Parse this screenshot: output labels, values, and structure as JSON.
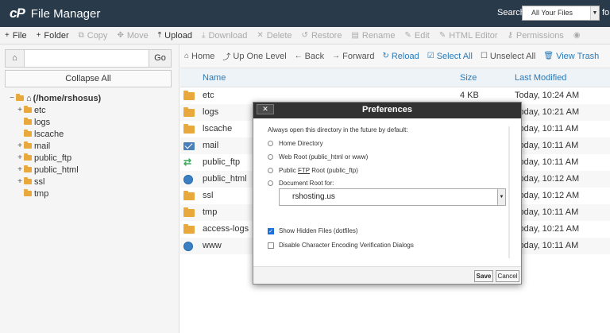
{
  "header": {
    "logo_mark": "cP",
    "title": "File Manager",
    "search_label": "Search",
    "search_scope": "All Your Files",
    "search_for_label": "fo"
  },
  "toolbar": {
    "items": [
      {
        "icon": "plus-icon",
        "glyph": "+",
        "label": "File",
        "enabled": true
      },
      {
        "icon": "plus-icon",
        "glyph": "+",
        "label": "Folder",
        "enabled": true
      },
      {
        "icon": "copy-icon",
        "glyph": "⧉",
        "label": "Copy",
        "enabled": false
      },
      {
        "icon": "move-icon",
        "glyph": "✥",
        "label": "Move",
        "enabled": false
      },
      {
        "icon": "upload-icon",
        "glyph": "⤒",
        "label": "Upload",
        "enabled": true
      },
      {
        "icon": "download-icon",
        "glyph": "⤓",
        "label": "Download",
        "enabled": false
      },
      {
        "icon": "delete-icon",
        "glyph": "✕",
        "label": "Delete",
        "enabled": false
      },
      {
        "icon": "restore-icon",
        "glyph": "↺",
        "label": "Restore",
        "enabled": false
      },
      {
        "icon": "rename-icon",
        "glyph": "▤",
        "label": "Rename",
        "enabled": false
      },
      {
        "icon": "edit-icon",
        "glyph": "✎",
        "label": "Edit",
        "enabled": false
      },
      {
        "icon": "html-editor-icon",
        "glyph": "✎",
        "label": "HTML Editor",
        "enabled": false
      },
      {
        "icon": "key-icon",
        "glyph": "⚷",
        "label": "Permissions",
        "enabled": false
      },
      {
        "icon": "view-icon",
        "glyph": "◉",
        "label": "",
        "enabled": false
      }
    ]
  },
  "left": {
    "path_value": "",
    "go_label": "Go",
    "collapse_label": "Collapse All",
    "tree": [
      {
        "toggle": "−",
        "label": "(/home/rshosus)",
        "depth": 0,
        "home": true
      },
      {
        "toggle": "+",
        "label": "etc",
        "depth": 1
      },
      {
        "toggle": "",
        "label": "logs",
        "depth": 1
      },
      {
        "toggle": "",
        "label": "lscache",
        "depth": 1
      },
      {
        "toggle": "+",
        "label": "mail",
        "depth": 1
      },
      {
        "toggle": "+",
        "label": "public_ftp",
        "depth": 1
      },
      {
        "toggle": "+",
        "label": "public_html",
        "depth": 1
      },
      {
        "toggle": "+",
        "label": "ssl",
        "depth": 1
      },
      {
        "toggle": "",
        "label": "tmp",
        "depth": 1
      }
    ]
  },
  "nav": {
    "items": [
      {
        "icon": "home-icon",
        "glyph": "⌂",
        "label": "Home",
        "blue": false
      },
      {
        "icon": "up-level-icon",
        "glyph": "⤴",
        "label": "Up One Level",
        "blue": false
      },
      {
        "icon": "back-icon",
        "glyph": "←",
        "label": "Back",
        "blue": false
      },
      {
        "icon": "forward-icon",
        "glyph": "→",
        "label": "Forward",
        "blue": false
      },
      {
        "icon": "reload-icon",
        "glyph": "↻",
        "label": "Reload",
        "blue": true
      },
      {
        "icon": "select-all-icon",
        "glyph": "☑",
        "label": "Select All",
        "blue": true
      },
      {
        "icon": "unselect-all-icon",
        "glyph": "☐",
        "label": "Unselect All",
        "blue": false
      },
      {
        "icon": "trash-icon",
        "glyph": "🗑",
        "label": "View Trash",
        "blue": true
      }
    ]
  },
  "columns": {
    "name": "Name",
    "size": "Size",
    "modified": "Last Modified"
  },
  "files": [
    {
      "name": "etc",
      "size": "4 KB",
      "modified": "Today, 10:24 AM",
      "kind": "folder"
    },
    {
      "name": "logs",
      "size": "",
      "modified": "Today, 10:21 AM",
      "kind": "folder"
    },
    {
      "name": "lscache",
      "size": "",
      "modified": "Today, 10:11 AM",
      "kind": "folder"
    },
    {
      "name": "mail",
      "size": "",
      "modified": "Today, 10:11 AM",
      "kind": "mail"
    },
    {
      "name": "public_ftp",
      "size": "",
      "modified": "Today, 10:11 AM",
      "kind": "link"
    },
    {
      "name": "public_html",
      "size": "",
      "modified": "Today, 10:12 AM",
      "kind": "globe"
    },
    {
      "name": "ssl",
      "size": "",
      "modified": "Today, 10:12 AM",
      "kind": "folder"
    },
    {
      "name": "tmp",
      "size": "",
      "modified": "Today, 10:11 AM",
      "kind": "folder"
    },
    {
      "name": "access-logs",
      "size": "",
      "modified": "Today, 10:21 AM",
      "kind": "folder"
    },
    {
      "name": "www",
      "size": "",
      "modified": "Today, 10:11 AM",
      "kind": "globe"
    }
  ],
  "modal": {
    "close_label": "✕",
    "title": "Preferences",
    "intro": "Always open this directory in the future by default:",
    "options": {
      "home": "Home Directory",
      "webroot": "Web Root (public_html or www)",
      "ftp_prefix": "Public ",
      "ftp_u": "FTP",
      "ftp_suffix": " Root (public_ftp)",
      "docroot": "Document Root for:"
    },
    "domain_value": "rshosting.us",
    "show_hidden": "Show Hidden Files (dotfiles)",
    "disable_encoding": "Disable Character Encoding Verification Dialogs",
    "save_label": "Save",
    "cancel_label": "Cancel"
  }
}
